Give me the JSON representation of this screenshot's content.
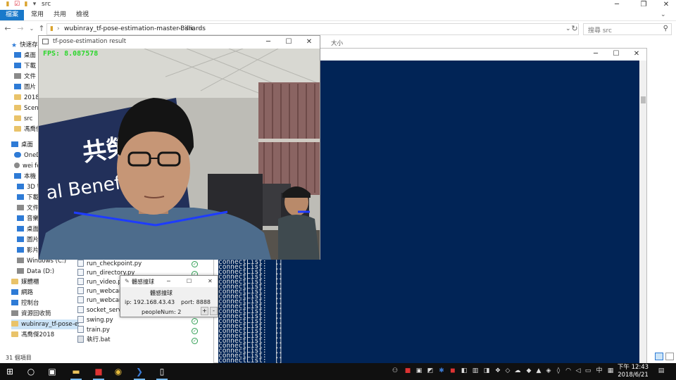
{
  "explorer": {
    "title": "src",
    "ribbon_tabs": [
      "檔案",
      "常用",
      "共用",
      "檢視"
    ],
    "breadcrumb": [
      "wubinray_tf-pose-estimation-master-Billiards",
      "src"
    ],
    "search_placeholder": "搜尋 src",
    "column_header": "大小",
    "status": "31 個項目",
    "nav_items": [
      "快速存取",
      "桌面",
      "下載",
      "文件",
      "圖片",
      "2018W",
      "Scene",
      "src",
      "馮喬傑",
      "桌面",
      "OneDri",
      "wei fe",
      "本機",
      "3D 物件",
      "下載",
      "文件",
      "音樂",
      "桌面",
      "圖片",
      "影片",
      "Windows (C:)",
      "Data (D:)",
      "媒體櫃",
      "網路",
      "控制台",
      "資源回收筒",
      "wubinray_tf-pose-estimati",
      "馮喬傑2018"
    ],
    "files": [
      "run_checkpoint.py",
      "run_directory.py",
      "run_video.py",
      "run_webcam.py",
      "run_webcam",
      "socket_server",
      "swing.py",
      "train.py",
      "執行.bat"
    ]
  },
  "console": {
    "lines": [
      "connectList:  []",
      "connectList:  []",
      "connectList:  []",
      "connectList:  []",
      "connectList:  []",
      "connectList:  []",
      "connectList:  []",
      "connectList:  []",
      "connectList:  []",
      "connectList:  []",
      "connectList:  []",
      "connectList:  []",
      "connectList:  []",
      "connectList:  []",
      "connectList:  []",
      "connectList:  []",
      "connectList:  []",
      "connectList:  []",
      "connectList:  []",
      "connectList:  []",
      "connectList:  []"
    ]
  },
  "pose_window": {
    "title": "tf-pose-estimation result",
    "fps_text": "FPS: 8.087578",
    "banner_text": "al Benefit",
    "banner_cjk": "共榮"
  },
  "dialog": {
    "title": "體感撞球",
    "heading": "體感撞球",
    "ip_label": "ip: 192.168.43.43",
    "port_label": "port: 8888",
    "people_label": "peopleNum: 2",
    "plus": "+",
    "minus": "-"
  },
  "taskbar": {
    "clock_time": "下午 12:43",
    "clock_date": "2018/6/21",
    "ime": "中"
  },
  "colors": {
    "console_bg": "#012456",
    "accent": "#1979ca",
    "fps_green": "#2bd62b",
    "skeleton_blue": "#1e3cff"
  }
}
